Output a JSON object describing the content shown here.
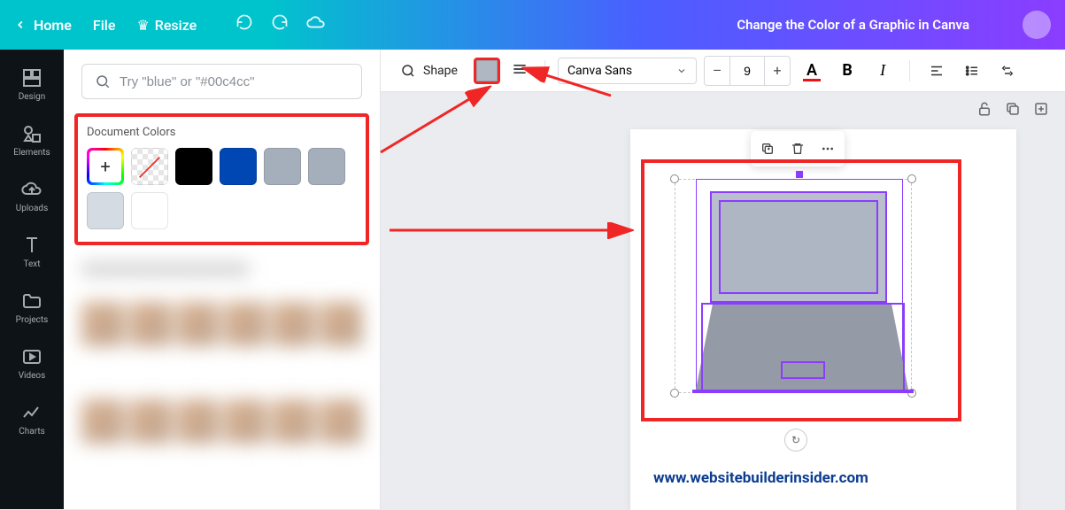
{
  "header": {
    "home": "Home",
    "file": "File",
    "resize": "Resize",
    "title": "Change the Color of a Graphic in Canva"
  },
  "nav": {
    "design": "Design",
    "elements": "Elements",
    "uploads": "Uploads",
    "text": "Text",
    "projects": "Projects",
    "videos": "Videos",
    "charts": "Charts"
  },
  "panel": {
    "search_placeholder": "Try \"blue\" or \"#00c4cc\"",
    "doc_colors_title": "Document Colors",
    "colors": {
      "black": "#000000",
      "blue": "#0047b3",
      "grey1": "#a5aebb",
      "grey2": "#a5aebb",
      "lightgrey": "#d4dbe3",
      "white": "#ffffff"
    }
  },
  "toolbar": {
    "shape": "Shape",
    "font": "Canva Sans",
    "font_size": "9",
    "minus": "–",
    "plus": "+",
    "text_color_letter": "A",
    "bold": "B",
    "italic": "I"
  },
  "watermark": "www.websitebuilderinsider.com"
}
